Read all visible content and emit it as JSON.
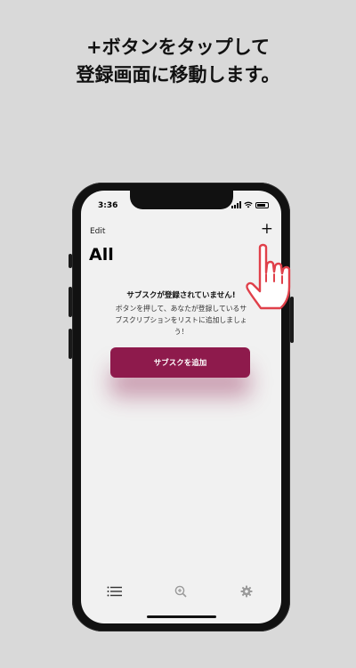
{
  "headline": {
    "line1": "+ボタンをタップして",
    "line2": "登録画面に移動します。"
  },
  "status_bar": {
    "time": "3:36"
  },
  "nav": {
    "edit_label": "Edit",
    "add_label": "+"
  },
  "page": {
    "title": "All"
  },
  "empty_state": {
    "title": "サブスクが登録されていません!",
    "desc_line1": "ボタンを押して、あなたが登録しているサ",
    "desc_line2": "ブスクリプションをリストに追加しましょ",
    "desc_line3": "う！",
    "button_label": "サブスクを追加"
  },
  "colors": {
    "accent": "#8e1a4c",
    "hand_outline": "#e0404a",
    "background": "#d9d9d9",
    "screen": "#f1f1f1"
  },
  "tabs": [
    {
      "icon": "list-icon"
    },
    {
      "icon": "search-zoom-icon"
    },
    {
      "icon": "gear-icon"
    }
  ]
}
